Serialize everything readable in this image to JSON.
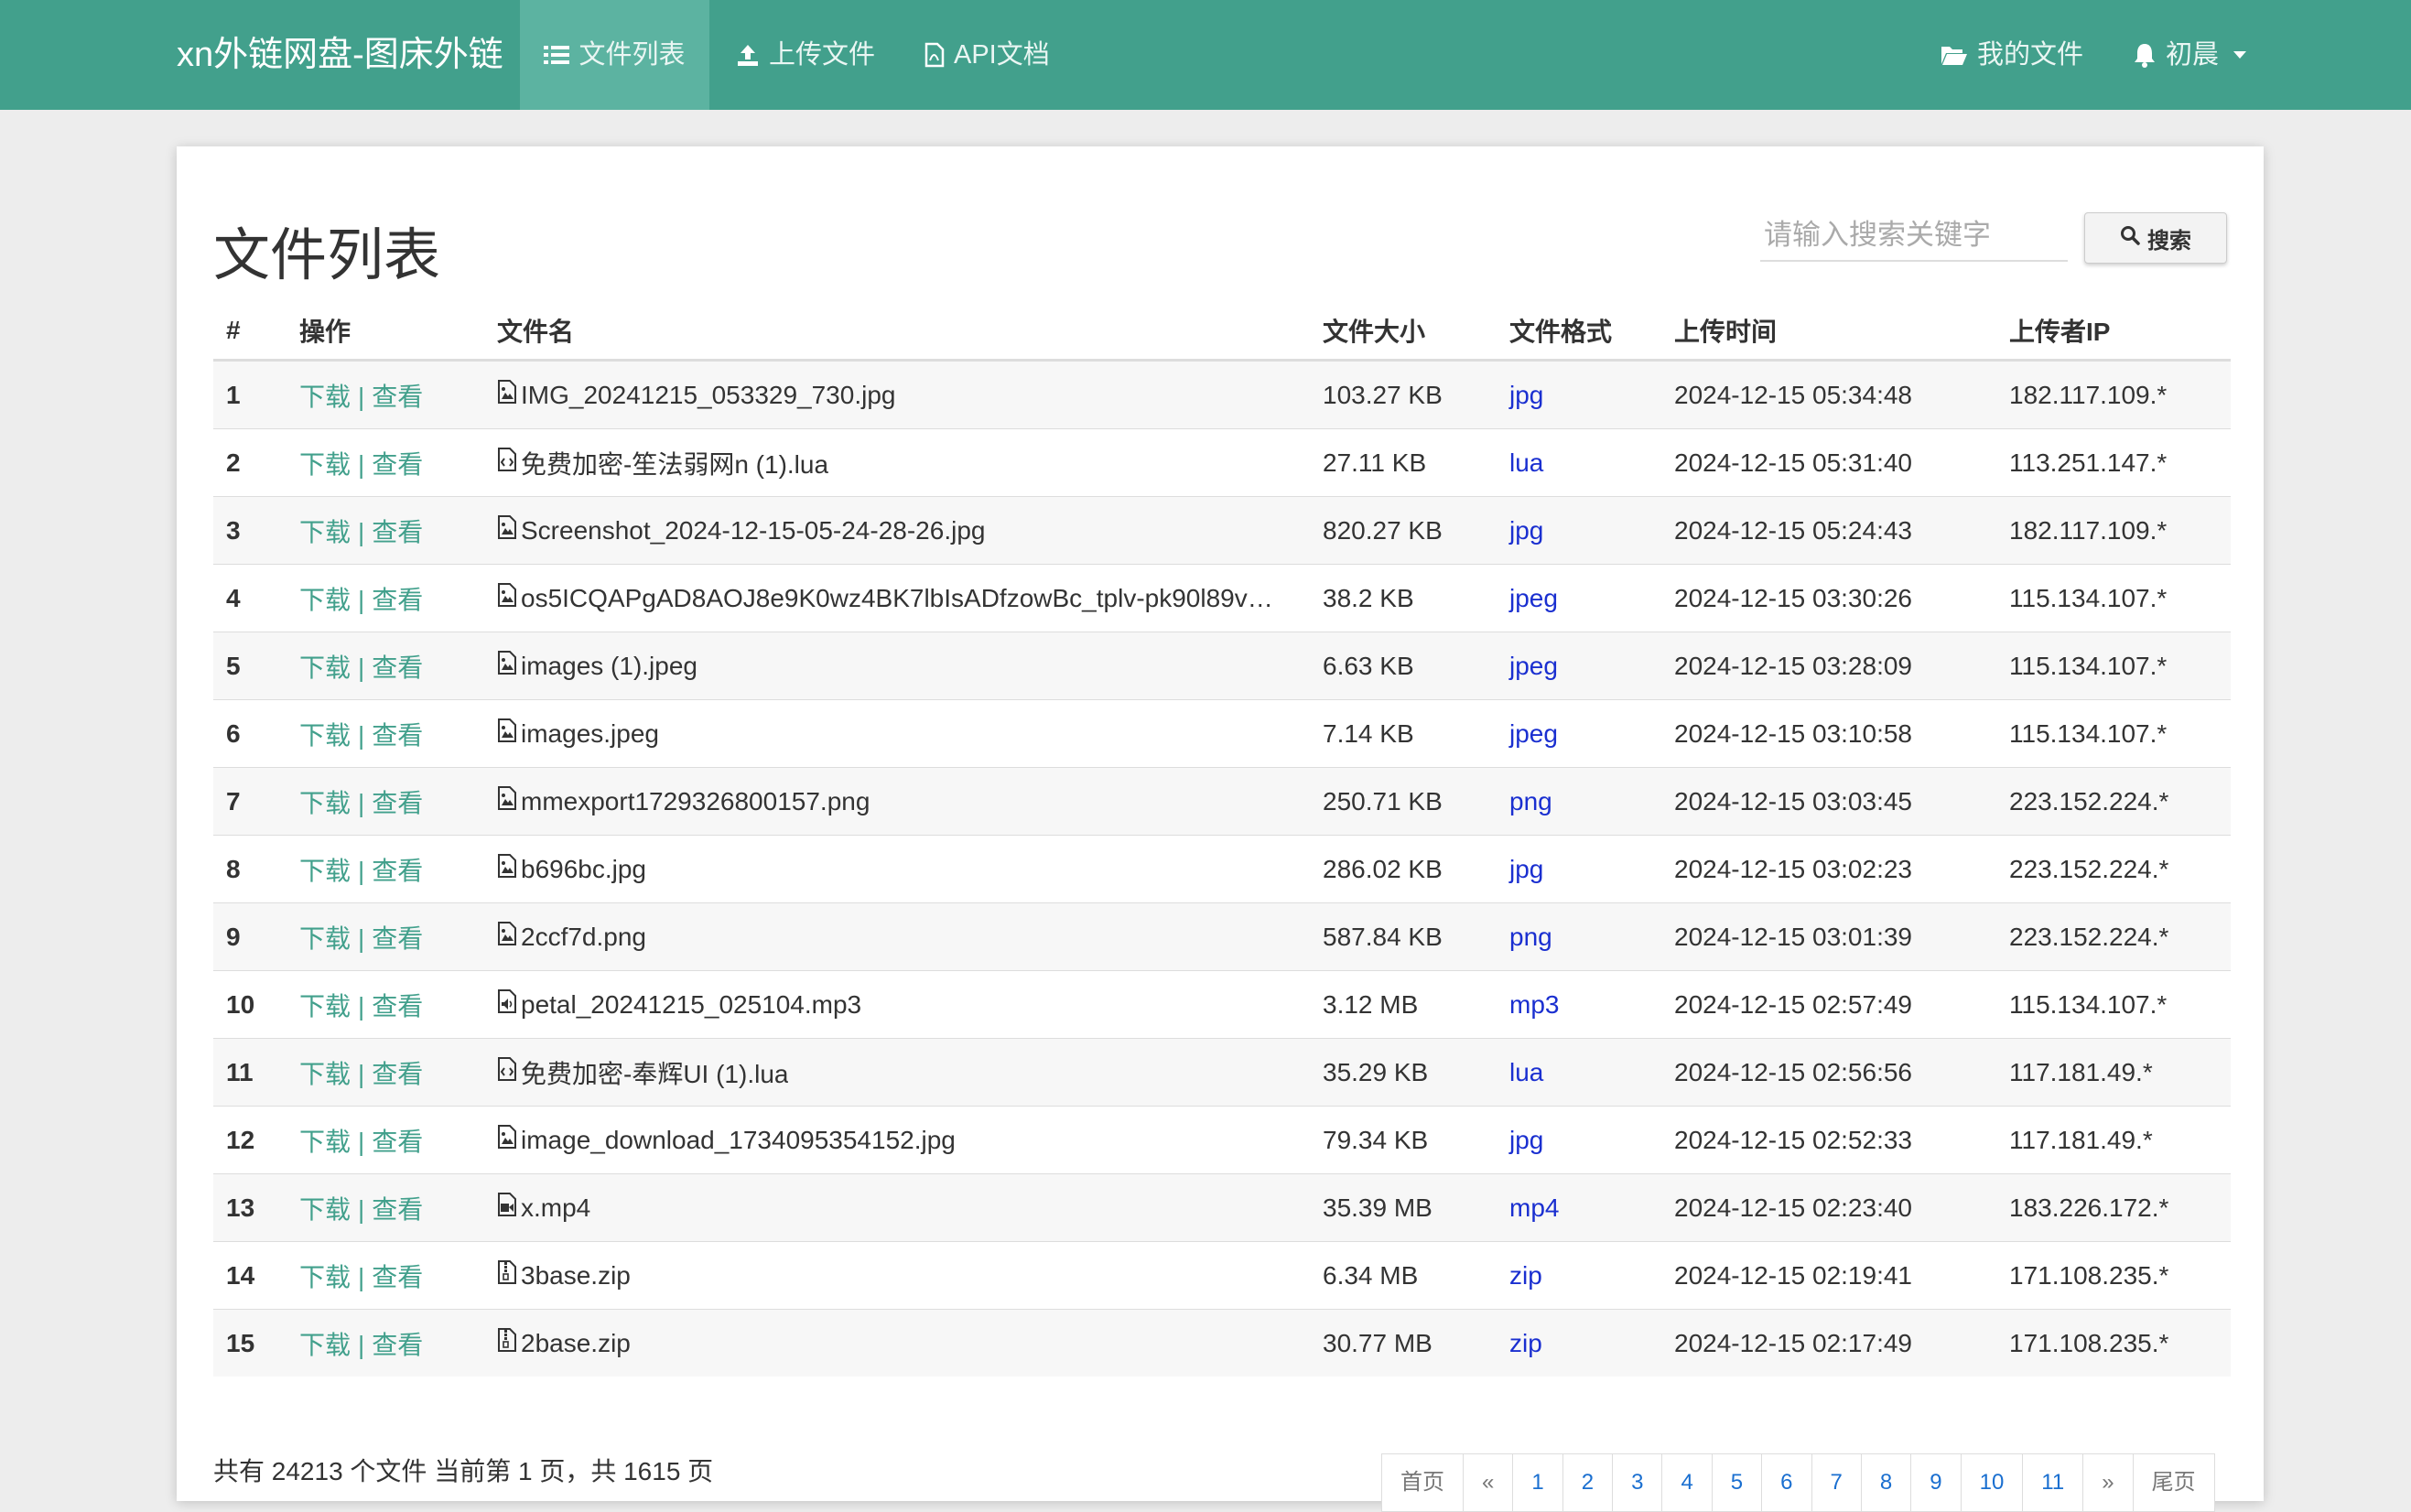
{
  "nav": {
    "brand": "xn外链网盘-图床外链",
    "items": [
      "文件列表",
      "上传文件",
      "API文档"
    ],
    "my_files": "我的文件",
    "user": "初晨"
  },
  "page": {
    "title": "文件列表",
    "search_placeholder": "请输入搜索关键字",
    "search_button": "搜索"
  },
  "table": {
    "headers": [
      "#",
      "操作",
      "文件名",
      "文件大小",
      "文件格式",
      "上传时间",
      "上传者IP"
    ],
    "action_download": "下载",
    "action_view": "查看",
    "rows": [
      {
        "n": "1",
        "icon": "image-file-icon",
        "name": "IMG_20241215_053329_730.jpg",
        "size": "103.27 KB",
        "fmt": "jpg",
        "time": "2024-12-15 05:34:48",
        "ip": "182.117.109.*"
      },
      {
        "n": "2",
        "icon": "code-file-icon",
        "name": "免费加密-笙法弱网n (1).lua",
        "size": "27.11 KB",
        "fmt": "lua",
        "time": "2024-12-15 05:31:40",
        "ip": "113.251.147.*"
      },
      {
        "n": "3",
        "icon": "image-file-icon",
        "name": "Screenshot_2024-12-15-05-24-28-26.jpg",
        "size": "820.27 KB",
        "fmt": "jpg",
        "time": "2024-12-15 05:24:43",
        "ip": "182.117.109.*"
      },
      {
        "n": "4",
        "icon": "image-file-icon",
        "name": "os5ICQAPgAD8AOJ8e9K0wz4BK7lbIsADfzowBc_tplv-pk90l89v…",
        "size": "38.2 KB",
        "fmt": "jpeg",
        "time": "2024-12-15 03:30:26",
        "ip": "115.134.107.*"
      },
      {
        "n": "5",
        "icon": "image-file-icon",
        "name": "images (1).jpeg",
        "size": "6.63 KB",
        "fmt": "jpeg",
        "time": "2024-12-15 03:28:09",
        "ip": "115.134.107.*"
      },
      {
        "n": "6",
        "icon": "image-file-icon",
        "name": "images.jpeg",
        "size": "7.14 KB",
        "fmt": "jpeg",
        "time": "2024-12-15 03:10:58",
        "ip": "115.134.107.*"
      },
      {
        "n": "7",
        "icon": "image-file-icon",
        "name": "mmexport1729326800157.png",
        "size": "250.71 KB",
        "fmt": "png",
        "time": "2024-12-15 03:03:45",
        "ip": "223.152.224.*"
      },
      {
        "n": "8",
        "icon": "image-file-icon",
        "name": "b696bc.jpg",
        "size": "286.02 KB",
        "fmt": "jpg",
        "time": "2024-12-15 03:02:23",
        "ip": "223.152.224.*"
      },
      {
        "n": "9",
        "icon": "image-file-icon",
        "name": "2ccf7d.png",
        "size": "587.84 KB",
        "fmt": "png",
        "time": "2024-12-15 03:01:39",
        "ip": "223.152.224.*"
      },
      {
        "n": "10",
        "icon": "audio-file-icon",
        "name": "petal_20241215_025104.mp3",
        "size": "3.12 MB",
        "fmt": "mp3",
        "time": "2024-12-15 02:57:49",
        "ip": "115.134.107.*"
      },
      {
        "n": "11",
        "icon": "code-file-icon",
        "name": "免费加密-奉辉UI (1).lua",
        "size": "35.29 KB",
        "fmt": "lua",
        "time": "2024-12-15 02:56:56",
        "ip": "117.181.49.*"
      },
      {
        "n": "12",
        "icon": "image-file-icon",
        "name": "image_download_1734095354152.jpg",
        "size": "79.34 KB",
        "fmt": "jpg",
        "time": "2024-12-15 02:52:33",
        "ip": "117.181.49.*"
      },
      {
        "n": "13",
        "icon": "video-file-icon",
        "name": "x.mp4",
        "size": "35.39 MB",
        "fmt": "mp4",
        "time": "2024-12-15 02:23:40",
        "ip": "183.226.172.*"
      },
      {
        "n": "14",
        "icon": "archive-file-icon",
        "name": "3base.zip",
        "size": "6.34 MB",
        "fmt": "zip",
        "time": "2024-12-15 02:19:41",
        "ip": "171.108.235.*"
      },
      {
        "n": "15",
        "icon": "archive-file-icon",
        "name": "2base.zip",
        "size": "30.77 MB",
        "fmt": "zip",
        "time": "2024-12-15 02:17:49",
        "ip": "171.108.235.*"
      }
    ]
  },
  "footer": {
    "summary": "共有 24213 个文件  当前第 1 页，共 1615 页",
    "pagination": [
      "首页",
      "«",
      "1",
      "2",
      "3",
      "4",
      "5",
      "6",
      "7",
      "8",
      "9",
      "10",
      "11",
      "»",
      "尾页"
    ]
  },
  "colors": {
    "navbar": "#42a08c",
    "nav_active": "#5cb3a1",
    "action_link": "#42a08c",
    "format_link": "#1a2fd0"
  }
}
